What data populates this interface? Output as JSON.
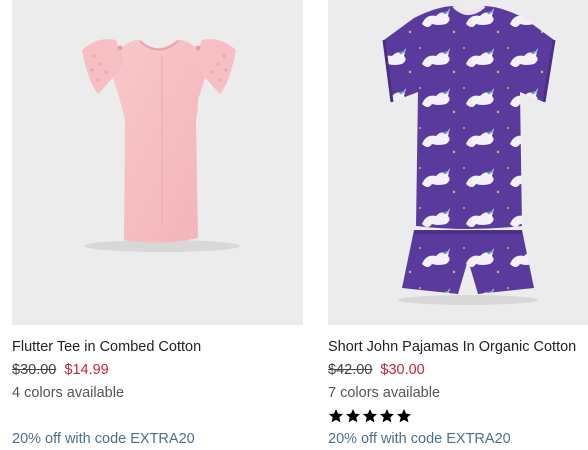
{
  "products": [
    {
      "name": "Flutter Tee in Combed Cotton",
      "price_was": "$30.00",
      "price_now": "$14.99",
      "colors": "4 colors available",
      "promo": "20% off with code EXTRA20",
      "image": "pink-flutter-tee",
      "bg_color": "#ececec"
    },
    {
      "name": "Short John Pajamas In Organic Cotton",
      "price_was": "$42.00",
      "price_now": "$30.00",
      "colors": "7 colors available",
      "rating": 5,
      "rating_max": 5,
      "promo": "20% off with code EXTRA20",
      "image": "purple-unicorn-pajamas",
      "bg_color": "#ececec"
    }
  ],
  "colors": {
    "sale_price": "#c4243b",
    "promo_text": "#4e6f8c",
    "pajama_purple": "#5b3a9e"
  }
}
